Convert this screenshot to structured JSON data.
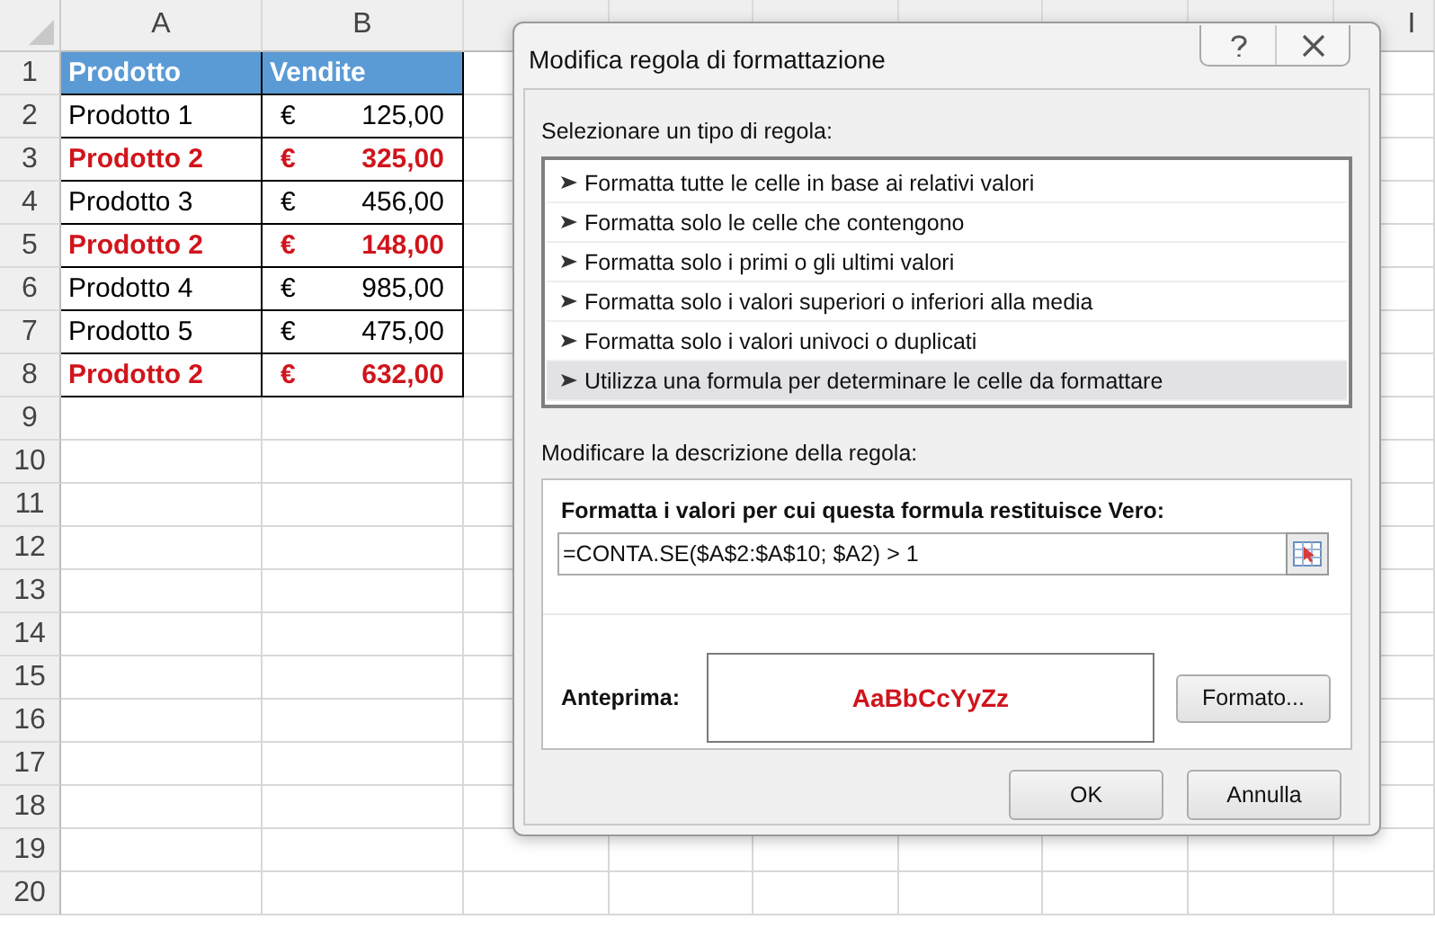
{
  "spreadsheet": {
    "column_headers": [
      "A",
      "B",
      "I"
    ],
    "row_numbers": [
      "1",
      "2",
      "3",
      "4",
      "5",
      "6",
      "7",
      "8",
      "9",
      "10",
      "11",
      "12",
      "13",
      "14",
      "15",
      "16",
      "17",
      "18",
      "19",
      "20"
    ],
    "table": {
      "columns": [
        "Prodotto",
        "Vendite"
      ],
      "rows": [
        {
          "product": "Prodotto 1",
          "currency": "€",
          "amount": "125,00",
          "highlighted": false
        },
        {
          "product": "Prodotto 2",
          "currency": "€",
          "amount": "325,00",
          "highlighted": true
        },
        {
          "product": "Prodotto 3",
          "currency": "€",
          "amount": "456,00",
          "highlighted": false
        },
        {
          "product": "Prodotto 2",
          "currency": "€",
          "amount": "148,00",
          "highlighted": true
        },
        {
          "product": "Prodotto 4",
          "currency": "€",
          "amount": "985,00",
          "highlighted": false
        },
        {
          "product": "Prodotto 5",
          "currency": "€",
          "amount": "475,00",
          "highlighted": false
        },
        {
          "product": "Prodotto 2",
          "currency": "€",
          "amount": "632,00",
          "highlighted": true
        }
      ]
    }
  },
  "dialog": {
    "title": "Modifica regola di formattazione",
    "rule_type_label": {
      "text": "Selezionare un tipo di regola:"
    },
    "rule_types": [
      {
        "label": "Formatta tutte le celle in base ai relativi valori",
        "selected": false
      },
      {
        "label": "Formatta solo le celle che contengono",
        "selected": false
      },
      {
        "label": "Formatta solo i primi o gli ultimi valori",
        "selected": false
      },
      {
        "label": "Formatta solo i valori superiori o inferiori alla media",
        "selected": false
      },
      {
        "label": "Formatta solo i valori univoci o duplicati",
        "selected": false
      },
      {
        "label": "Utilizza una formula per determinare le celle da formattare",
        "selected": true
      }
    ],
    "description_label": {
      "text": "Modificare la descrizione della regola:"
    },
    "formula_label": {
      "text": "Formatta i valori per cui questa formula restituisce Vero:"
    },
    "formula": "=CONTA.SE($A$2:$A$10; $A2) > 1",
    "preview_label": "Anteprima:",
    "preview_text": "AaBbCcYyZz",
    "format_button": {
      "text": "Formato..."
    },
    "buttons": [
      "OK",
      "Annulla"
    ]
  }
}
